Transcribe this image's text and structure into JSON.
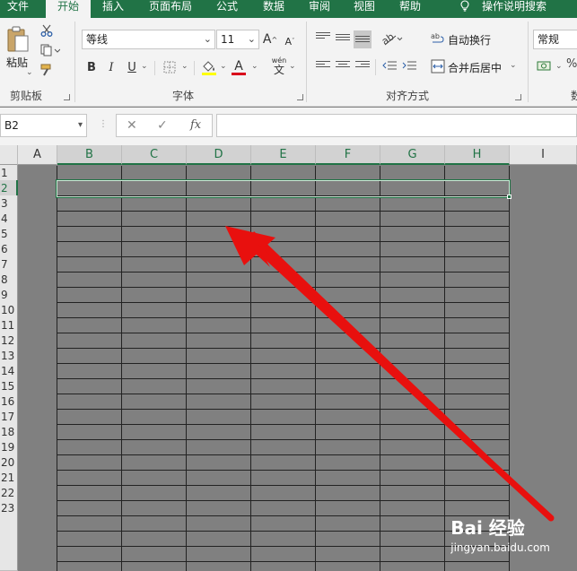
{
  "tabs": [
    {
      "label": "文件",
      "active": false
    },
    {
      "label": "开始",
      "active": true
    },
    {
      "label": "插入",
      "active": false
    },
    {
      "label": "页面布局",
      "active": false
    },
    {
      "label": "公式",
      "active": false
    },
    {
      "label": "数据",
      "active": false
    },
    {
      "label": "审阅",
      "active": false
    },
    {
      "label": "视图",
      "active": false
    },
    {
      "label": "帮助",
      "active": false
    }
  ],
  "tell_me": "操作说明搜索",
  "clipboard": {
    "paste_label": "粘贴",
    "group_label": "剪贴板"
  },
  "font": {
    "family": "等线",
    "size": "11",
    "grow": "A",
    "shrink": "A",
    "bold": "B",
    "italic": "I",
    "underline": "U",
    "font_color_letter": "A",
    "wen": "wén",
    "wen_char": "文",
    "group_label": "字体",
    "accent_color": "#d9001b"
  },
  "alignment": {
    "wrap_text": "自动换行",
    "merge_center": "合并后居中",
    "group_label": "对齐方式"
  },
  "number": {
    "format": "常规",
    "group_label_partial": "数"
  },
  "formula_bar": {
    "name_box": "B2",
    "cancel": "✕",
    "enter": "✓",
    "fx": "fx",
    "value": ""
  },
  "columns": [
    "A",
    "B",
    "C",
    "D",
    "E",
    "F",
    "G",
    "H",
    "I"
  ],
  "selected_columns": [
    "B",
    "C",
    "D",
    "E",
    "F",
    "G",
    "H"
  ],
  "rows": [
    "1",
    "2",
    "3",
    "4",
    "5",
    "6",
    "7",
    "8",
    "9",
    "10",
    "11",
    "12",
    "13",
    "14",
    "15",
    "16",
    "17",
    "18",
    "19",
    "20",
    "21",
    "22",
    "23"
  ],
  "selected_row": "2",
  "selection": "B2:H2",
  "watermark": {
    "brand": "Bai 经验",
    "url": "jingyan.baidu.com"
  },
  "colors": {
    "excel_green": "#217346",
    "arrow_red": "#e8100e",
    "sheet_gray": "#808080"
  }
}
